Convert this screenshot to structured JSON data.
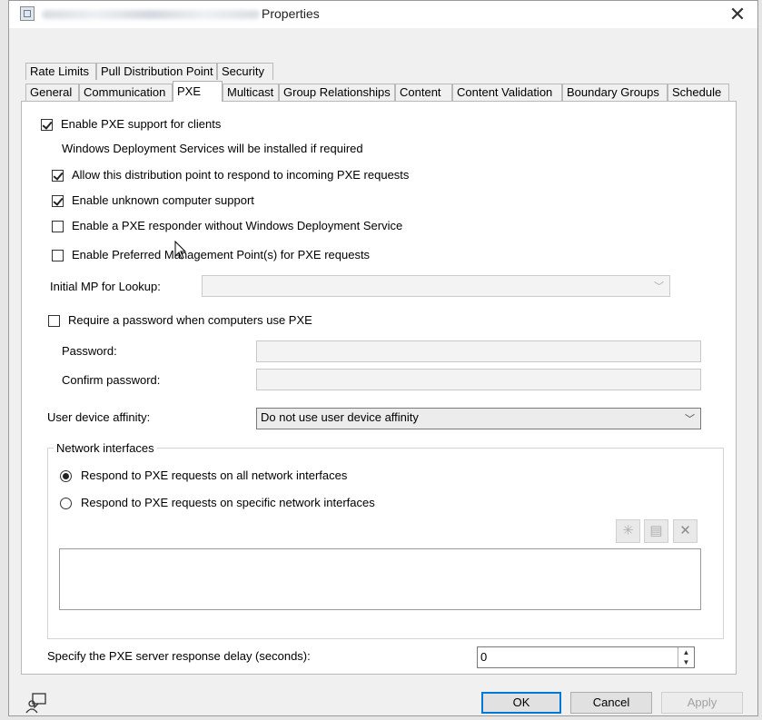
{
  "window": {
    "title_suffix": "Properties",
    "close_glyph": "✕"
  },
  "tabs": {
    "row1": [
      "Rate Limits",
      "Pull Distribution Point",
      "Security"
    ],
    "row2": [
      "General",
      "Communication",
      "PXE",
      "Multicast",
      "Group Relationships",
      "Content",
      "Content Validation",
      "Boundary Groups",
      "Schedule"
    ],
    "active": "PXE"
  },
  "pxe": {
    "enable_pxe": {
      "label": "Enable PXE support for clients",
      "checked": true
    },
    "wds_note": "Windows Deployment Services will be installed if required",
    "allow_respond": {
      "label": "Allow this distribution point to respond to incoming PXE requests",
      "checked": true
    },
    "unknown_computer": {
      "label": "Enable unknown computer support",
      "checked": true
    },
    "responder_without_wds": {
      "label": "Enable a PXE responder without Windows Deployment Service",
      "checked": false
    },
    "preferred_mp": {
      "label": "Enable Preferred Management Point(s) for PXE requests",
      "checked": false
    },
    "initial_mp_label": "Initial MP for Lookup:",
    "initial_mp_value": "",
    "require_password": {
      "label": "Require a password when computers use PXE",
      "checked": false
    },
    "password_label": "Password:",
    "confirm_password_label": "Confirm password:",
    "uda_label": "User device affinity:",
    "uda_value": "Do not use user device affinity",
    "network_group_label": "Network interfaces",
    "radio_all": {
      "label": "Respond to PXE requests on all network interfaces",
      "checked": true
    },
    "radio_specific": {
      "label": "Respond to PXE requests on specific network interfaces",
      "checked": false
    },
    "delay_label": "Specify the PXE server response delay (seconds):",
    "delay_value": "0"
  },
  "buttons": {
    "ok": "OK",
    "cancel": "Cancel",
    "apply": "Apply"
  },
  "icons": {
    "title": "properties-window-icon",
    "help": "help-person-icon",
    "toolbar": [
      "new-icon",
      "properties-icon",
      "delete-icon"
    ]
  },
  "colors": {
    "default_button_border": "#0078d7"
  }
}
